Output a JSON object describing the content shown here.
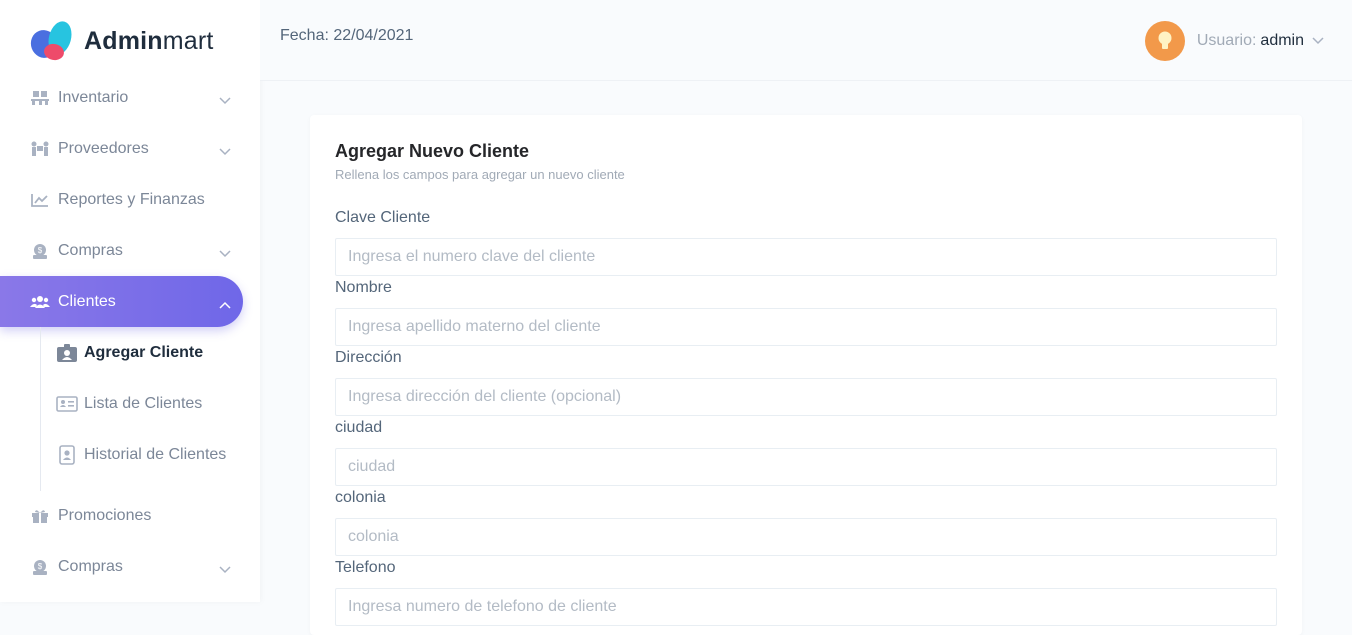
{
  "app": {
    "logo_bold": "Admin",
    "logo_light": "mart"
  },
  "sidebar": {
    "items": [
      {
        "label": "Inventario",
        "icon": "pallet-icon"
      },
      {
        "label": "Proveedores",
        "icon": "people-carry-icon"
      },
      {
        "label": "Reportes y Finanzas",
        "icon": "chart-line-icon"
      },
      {
        "label": "Compras",
        "icon": "money-bag-icon"
      },
      {
        "label": "Clientes",
        "icon": "users-icon"
      },
      {
        "label": "Promociones",
        "icon": "gift-icon"
      },
      {
        "label": "Compras",
        "icon": "money-bag-icon"
      }
    ],
    "clientes_sub": [
      {
        "label": "Agregar Cliente",
        "icon": "id-card-alt-icon"
      },
      {
        "label": "Lista de Clientes",
        "icon": "address-card-icon"
      },
      {
        "label": "Historial de Clientes",
        "icon": "id-badge-icon"
      }
    ]
  },
  "header": {
    "fecha": "Fecha: 22/04/2021",
    "user_label": "Usuario:",
    "user_name": "admin"
  },
  "form": {
    "title": "Agregar Nuevo Cliente",
    "subtitle": "Rellena los campos para agregar un nuevo cliente",
    "fields": [
      {
        "label": "Clave Cliente",
        "placeholder": "Ingresa el numero clave del cliente"
      },
      {
        "label": "Nombre",
        "placeholder": "Ingresa apellido materno del cliente"
      },
      {
        "label": "Dirección",
        "placeholder": "Ingresa dirección del cliente (opcional)"
      },
      {
        "label": "ciudad",
        "placeholder": "ciudad"
      },
      {
        "label": "colonia",
        "placeholder": "colonia"
      },
      {
        "label": "Telefono",
        "placeholder": "Ingresa numero de telefono de cliente"
      }
    ]
  },
  "colors": {
    "accent": "#7a6fe8",
    "avatar": "#f2994a"
  }
}
